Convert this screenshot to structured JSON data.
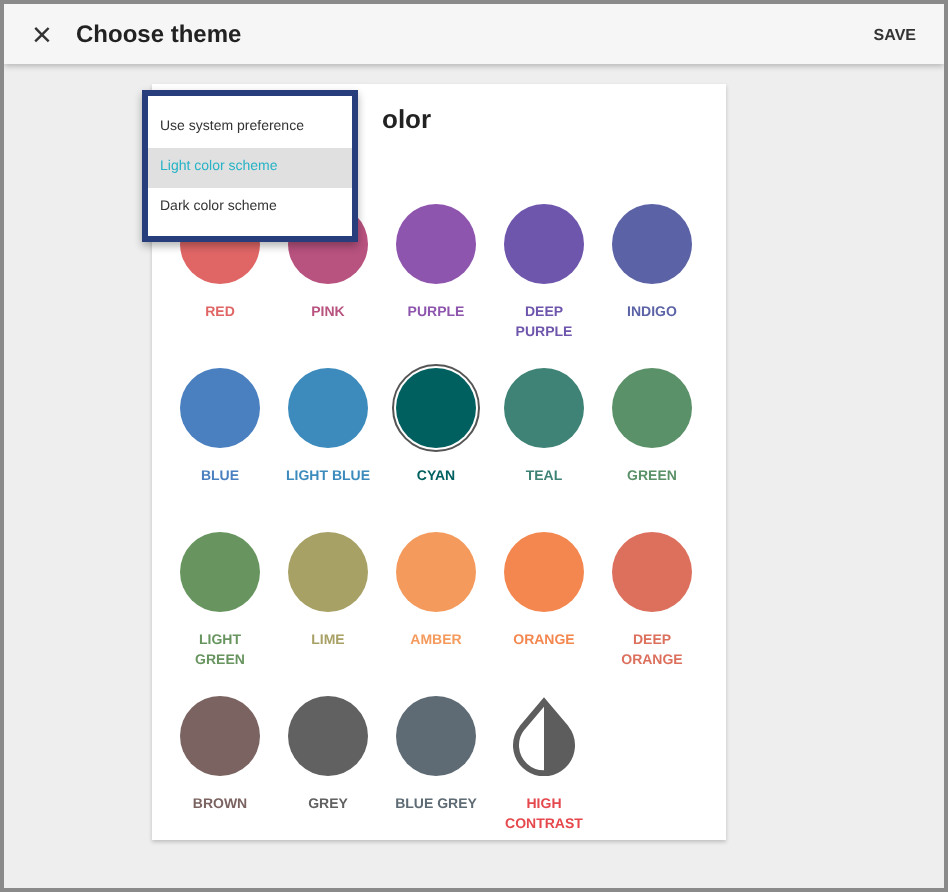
{
  "window": {
    "title": "Choose theme",
    "close": "×",
    "action": "SAVE"
  },
  "card": {
    "title": "olor"
  },
  "menu": [
    {
      "label": "Use system preference",
      "selected": false
    },
    {
      "label": "Light color scheme",
      "selected": true
    },
    {
      "label": "Dark color scheme",
      "selected": false
    }
  ],
  "swatches": [
    {
      "label": "RED",
      "color": "#e06666",
      "kind": "circle",
      "selected": false
    },
    {
      "label": "PINK",
      "color": "#b8527f",
      "kind": "circle",
      "selected": false
    },
    {
      "label": "PURPLE",
      "color": "#8e55ae",
      "kind": "circle",
      "selected": false
    },
    {
      "label": "DEEP PURPLE",
      "color": "#6f56ad",
      "kind": "circle",
      "selected": false
    },
    {
      "label": "INDIGO",
      "color": "#5b63a6",
      "kind": "circle",
      "selected": false
    },
    {
      "label": "BLUE",
      "color": "#4a7fc0",
      "kind": "circle",
      "selected": false
    },
    {
      "label": "LIGHT BLUE",
      "color": "#3d8bbd",
      "kind": "circle",
      "selected": false
    },
    {
      "label": "CYAN",
      "color": "#00605f",
      "kind": "circle",
      "selected": true
    },
    {
      "label": "TEAL",
      "color": "#3f8377",
      "kind": "circle",
      "selected": false
    },
    {
      "label": "GREEN",
      "color": "#5b9168",
      "kind": "circle",
      "selected": false
    },
    {
      "label": "LIGHT GREEN",
      "color": "#68955f",
      "kind": "circle",
      "selected": false
    },
    {
      "label": "LIME",
      "color": "#a8a166",
      "kind": "circle",
      "selected": false
    },
    {
      "label": "AMBER",
      "color": "#f49a5c",
      "kind": "circle",
      "selected": false
    },
    {
      "label": "ORANGE",
      "color": "#f3874f",
      "kind": "circle",
      "selected": false
    },
    {
      "label": "DEEP ORANGE",
      "color": "#dc705d",
      "kind": "circle",
      "selected": false
    },
    {
      "label": "BROWN",
      "color": "#7a6360",
      "kind": "circle",
      "selected": false
    },
    {
      "label": "GREY",
      "color": "#616161",
      "kind": "circle",
      "selected": false
    },
    {
      "label": "BLUE GREY",
      "color": "#5e6b74",
      "kind": "circle",
      "selected": false
    },
    {
      "label": "HIGH CONTRAST",
      "color": "#e5484d",
      "kind": "contrast",
      "selected": false
    }
  ]
}
